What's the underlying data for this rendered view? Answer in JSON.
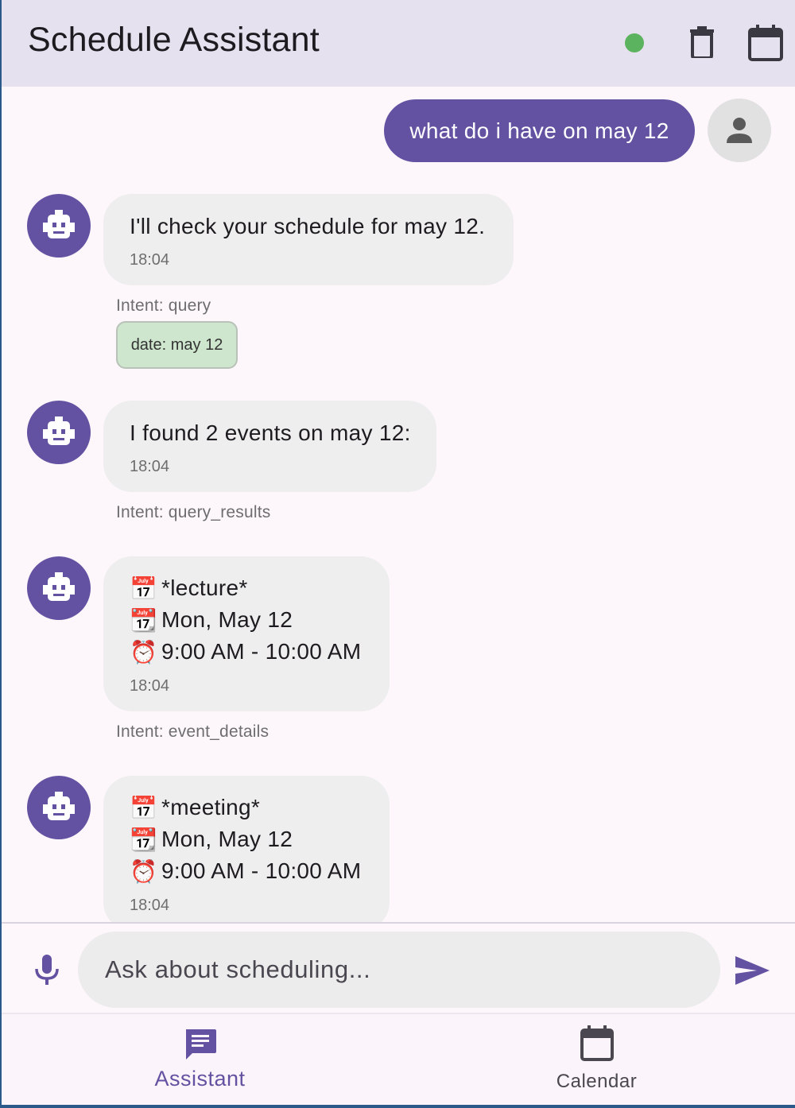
{
  "app": {
    "title": "Schedule Assistant",
    "status_color": "#5cb35f",
    "accent_color": "#6352a1"
  },
  "header_icons": [
    "status-indicator",
    "delete-icon",
    "calendar-icon"
  ],
  "messages": [
    {
      "sender": "user",
      "text": "what do i have on may 12"
    },
    {
      "sender": "bot",
      "text": "I'll check your schedule for may 12.",
      "time": "18:04",
      "intent": "Intent: query",
      "chip": "date: may 12"
    },
    {
      "sender": "bot",
      "text": "I found 2 events on may 12:",
      "time": "18:04",
      "intent": "Intent: query_results"
    },
    {
      "sender": "bot",
      "lines": [
        {
          "emoji": "📅",
          "text": "*lecture*"
        },
        {
          "emoji": "📆",
          "text": "Mon, May 12"
        },
        {
          "emoji": "⏰",
          "text": "9:00 AM - 10:00 AM"
        }
      ],
      "time": "18:04",
      "intent": "Intent: event_details"
    },
    {
      "sender": "bot",
      "lines": [
        {
          "emoji": "📅",
          "text": "*meeting*"
        },
        {
          "emoji": "📆",
          "text": "Mon, May 12"
        },
        {
          "emoji": "⏰",
          "text": "9:00 AM - 10:00 AM"
        }
      ],
      "time": "18:04"
    }
  ],
  "input": {
    "placeholder": "Ask about scheduling..."
  },
  "nav": {
    "items": [
      {
        "label": "Assistant",
        "icon": "chat-icon",
        "active": true
      },
      {
        "label": "Calendar",
        "icon": "calendar-icon",
        "active": false
      }
    ]
  }
}
